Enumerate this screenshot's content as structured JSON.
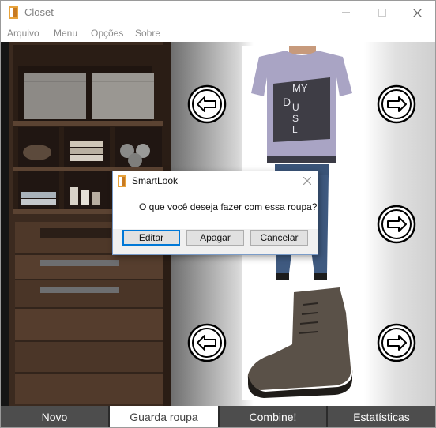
{
  "window": {
    "title": "Closet"
  },
  "menu": {
    "items": [
      "Arquivo",
      "Menu",
      "Opções",
      "Sobre"
    ]
  },
  "tabs": [
    {
      "label": "Novo",
      "active": false
    },
    {
      "label": "Guarda roupa",
      "active": true
    },
    {
      "label": "Combine!",
      "active": false
    },
    {
      "label": "Estatísticas",
      "active": false
    }
  ],
  "dialog": {
    "title": "SmartLook",
    "message": "O que você deseja fazer com essa roupa?",
    "buttons": [
      "Editar",
      "Apagar",
      "Cancelar"
    ],
    "default_button": "Editar"
  },
  "shirt_text": [
    "D",
    "MY",
    "U",
    "S",
    "L"
  ],
  "colors": {
    "tab_bar": "#4d4d4d",
    "dialog_focus": "#0078d7",
    "shirt": "#a9a4c4",
    "jeans": "#3f5a80",
    "boot": "#5a5148"
  },
  "icons": {
    "left": "arrow-left-circle-icon",
    "right": "arrow-right-circle-icon"
  }
}
